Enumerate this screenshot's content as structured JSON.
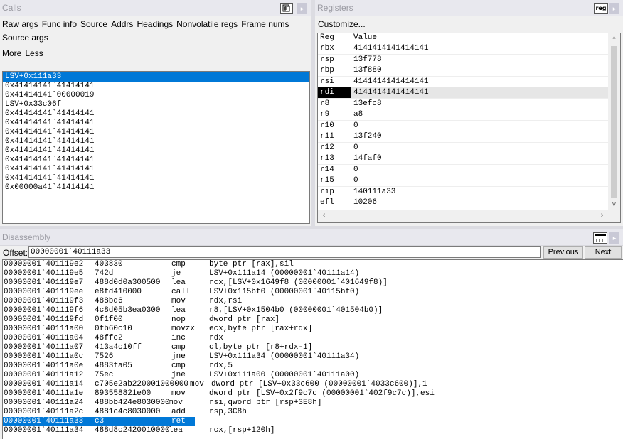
{
  "calls": {
    "title": "Calls",
    "options_row1": [
      "Raw args",
      "Func info",
      "Source",
      "Addrs",
      "Headings",
      "Nonvolatile regs",
      "Frame nums"
    ],
    "options_row2": [
      "Source args"
    ],
    "options_row3": [
      "More",
      "Less"
    ],
    "frames": [
      "LSV+0x111a33",
      "0x41414141`41414141",
      "0x41414141`00000019",
      "LSV+0x33c06f",
      "0x41414141`41414141",
      "0x41414141`41414141",
      "0x41414141`41414141",
      "0x41414141`41414141",
      "0x41414141`41414141",
      "0x41414141`41414141",
      "0x41414141`41414141",
      "0x41414141`41414141",
      "0x00000a41`41414141"
    ]
  },
  "registers": {
    "title": "Registers",
    "icon_label": "reg",
    "customize": "Customize...",
    "headers": [
      "Reg",
      "Value"
    ],
    "rows": [
      {
        "reg": "rbx",
        "value": "4141414141414141"
      },
      {
        "reg": "rsp",
        "value": "13f778"
      },
      {
        "reg": "rbp",
        "value": "13f880"
      },
      {
        "reg": "rsi",
        "value": "4141414141414141"
      },
      {
        "reg": "rdi",
        "value": "4141414141414141"
      },
      {
        "reg": "r8",
        "value": "13efc8"
      },
      {
        "reg": "r9",
        "value": "a8"
      },
      {
        "reg": "r10",
        "value": "0"
      },
      {
        "reg": "r11",
        "value": "13f240"
      },
      {
        "reg": "r12",
        "value": "0"
      },
      {
        "reg": "r13",
        "value": "14faf0"
      },
      {
        "reg": "r14",
        "value": "0"
      },
      {
        "reg": "r15",
        "value": "0"
      },
      {
        "reg": "rip",
        "value": "140111a33"
      },
      {
        "reg": "efl",
        "value": "10206"
      }
    ]
  },
  "disassembly": {
    "title": "Disassembly",
    "offset_label": "Offset:",
    "offset_value": "00000001`40111a33",
    "previous": "Previous",
    "next": "Next",
    "lines": [
      {
        "addr": "00000001`401119e2",
        "bytes": "403830",
        "op": "cmp",
        "args": "byte ptr [rax],sil"
      },
      {
        "addr": "00000001`401119e5",
        "bytes": "742d",
        "op": "je",
        "args": "LSV+0x111a14 (00000001`40111a14)"
      },
      {
        "addr": "00000001`401119e7",
        "bytes": "488d0d0a300500",
        "op": "lea",
        "args": "rcx,[LSV+0x1649f8 (00000001`401649f8)]"
      },
      {
        "addr": "00000001`401119ee",
        "bytes": "e8fd410000",
        "op": "call",
        "args": "LSV+0x115bf0 (00000001`40115bf0)"
      },
      {
        "addr": "00000001`401119f3",
        "bytes": "488bd6",
        "op": "mov",
        "args": "rdx,rsi"
      },
      {
        "addr": "00000001`401119f6",
        "bytes": "4c8d05b3ea0300",
        "op": "lea",
        "args": "r8,[LSV+0x1504b0 (00000001`401504b0)]"
      },
      {
        "addr": "00000001`401119fd",
        "bytes": "0f1f00",
        "op": "nop",
        "args": "dword ptr [rax]"
      },
      {
        "addr": "00000001`40111a00",
        "bytes": "0fb60c10",
        "op": "movzx",
        "args": "ecx,byte ptr [rax+rdx]"
      },
      {
        "addr": "00000001`40111a04",
        "bytes": "48ffc2",
        "op": "inc",
        "args": "rdx"
      },
      {
        "addr": "00000001`40111a07",
        "bytes": "413a4c10ff",
        "op": "cmp",
        "args": "cl,byte ptr [r8+rdx-1]"
      },
      {
        "addr": "00000001`40111a0c",
        "bytes": "7526",
        "op": "jne",
        "args": "LSV+0x111a34 (00000001`40111a34)"
      },
      {
        "addr": "00000001`40111a0e",
        "bytes": "4883fa05",
        "op": "cmp",
        "args": "rdx,5"
      },
      {
        "addr": "00000001`40111a12",
        "bytes": "75ec",
        "op": "jne",
        "args": "LSV+0x111a00 (00000001`40111a00)"
      },
      {
        "addr": "00000001`40111a14",
        "bytes": "c705e2ab220001000000",
        "op": "mov",
        "args": "dword ptr [LSV+0x33c600 (00000001`4033c600)],1"
      },
      {
        "addr": "00000001`40111a1e",
        "bytes": "893558821e00",
        "op": "mov",
        "args": "dword ptr [LSV+0x2f9c7c (00000001`402f9c7c)],esi"
      },
      {
        "addr": "00000001`40111a24",
        "bytes": "488bb424e8030000",
        "op": "mov",
        "args": "rsi,qword ptr [rsp+3E8h]"
      },
      {
        "addr": "00000001`40111a2c",
        "bytes": "4881c4c8030000",
        "op": "add",
        "args": "rsp,3C8h"
      },
      {
        "addr": "00000001`40111a33",
        "bytes": "c3",
        "op": "ret",
        "args": ""
      },
      {
        "addr": "00000001`40111a34",
        "bytes": "488d8c2420010000",
        "op": "lea",
        "args": "rcx,[rsp+120h]"
      }
    ]
  }
}
